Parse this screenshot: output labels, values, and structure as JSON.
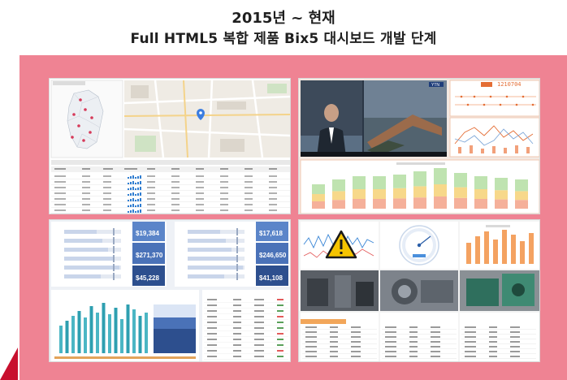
{
  "heading": {
    "line1": "2015년 ~ 현재",
    "line2": "Full HTML5 복합 제품 Bix5 대시보드 개발 단계"
  },
  "colors": {
    "band": "#ef8393",
    "accent_red": "#c8102e",
    "kpi_blue": "#4a72b8",
    "kpi_dark": "#2d4f8e",
    "warning_yellow": "#f5c400"
  },
  "dashboard_left_bottom": {
    "kpis": [
      {
        "value": "$19,384"
      },
      {
        "value": "$271,370"
      },
      {
        "value": "$45,228"
      }
    ],
    "kpis_right": [
      {
        "value": "$17,618"
      },
      {
        "value": "$246,650"
      },
      {
        "value": "$41,108"
      }
    ]
  },
  "dashboard_right_top": {
    "ticker": "1210704",
    "logo": "YTN"
  },
  "icons": [
    "warning-icon",
    "gauge-icon",
    "map-pin-icon"
  ]
}
